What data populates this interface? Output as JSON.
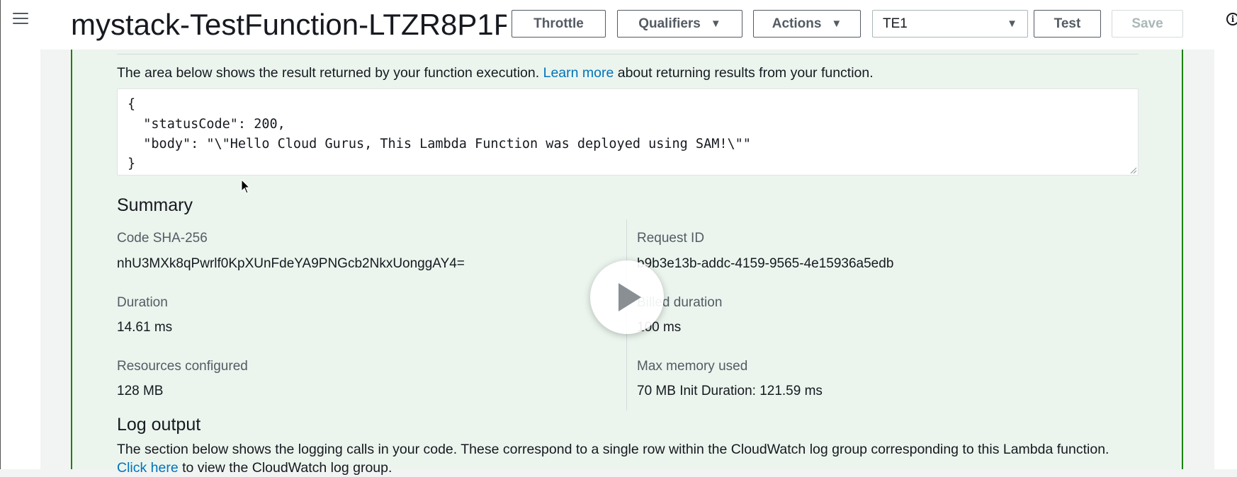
{
  "header": {
    "function_name": "mystack-TestFunction-LTZR8P1P…",
    "throttle_label": "Throttle",
    "qualifiers_label": "Qualifiers",
    "actions_label": "Actions",
    "test_event_selected": "TE1",
    "test_label": "Test",
    "save_label": "Save"
  },
  "result": {
    "description_prefix": "The area below shows the result returned by your function execution.",
    "learn_more": "Learn more",
    "description_suffix": "about returning results from your function.",
    "output": "{\n  \"statusCode\": 200,\n  \"body\": \"\\\"Hello Cloud Gurus, This Lambda Function was deployed using SAM!\\\"\"\n}"
  },
  "summary": {
    "heading": "Summary",
    "code_sha_label": "Code SHA-256",
    "code_sha_value": "nhU3MXk8qPwrlf0KpXUnFdeYA9PNGcb2NkxUonggAY4=",
    "request_id_label": "Request ID",
    "request_id_value": "b9b3e13b-addc-4159-9565-4e15936a5edb",
    "duration_label": "Duration",
    "duration_value": "14.61 ms",
    "billed_duration_label": "Billed duration",
    "billed_duration_value": "100 ms",
    "resources_label": "Resources configured",
    "resources_value": "128 MB",
    "max_memory_label": "Max memory used",
    "max_memory_value": "70 MB Init Duration: 121.59 ms"
  },
  "log": {
    "heading": "Log output",
    "description": "The section below shows the logging calls in your code. These correspond to a single row within the CloudWatch log group corresponding to this Lambda function.",
    "click_here": "Click here",
    "view_suffix": "to view the CloudWatch log group."
  },
  "icons": {
    "menu": "hamburger-icon",
    "info": "info-icon",
    "caret": "caret-down-icon",
    "play": "play-icon",
    "cursor": "mouse-cursor-icon"
  },
  "colors": {
    "success_border": "#1d8102",
    "panel_background": "#ebf5ee",
    "link": "#0073bb"
  }
}
